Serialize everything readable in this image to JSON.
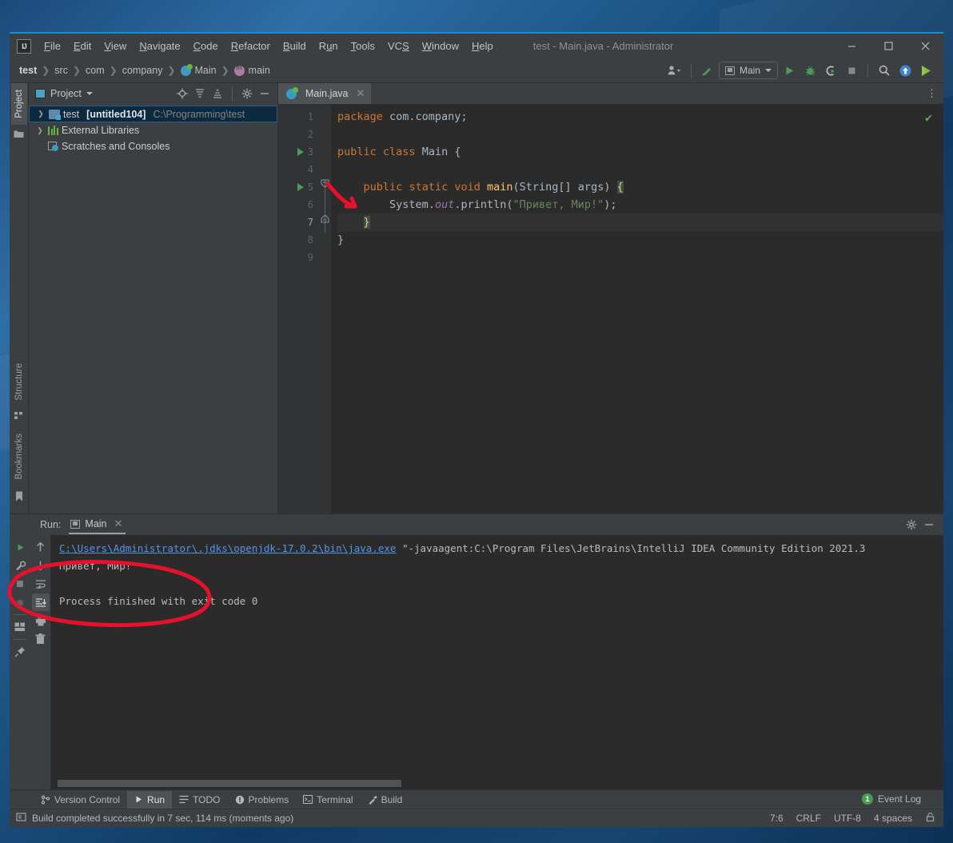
{
  "window": {
    "title": "test - Main.java - Administrator",
    "logo_text": "IJ",
    "controls": {
      "minimize": "—",
      "maximize": "☐",
      "close": "✕"
    }
  },
  "menu": [
    {
      "label": "File",
      "accel": "F"
    },
    {
      "label": "Edit",
      "accel": "E"
    },
    {
      "label": "View",
      "accel": "V"
    },
    {
      "label": "Navigate",
      "accel": "N"
    },
    {
      "label": "Code",
      "accel": "C"
    },
    {
      "label": "Refactor",
      "accel": "R"
    },
    {
      "label": "Build",
      "accel": "B"
    },
    {
      "label": "Run",
      "accel": "u"
    },
    {
      "label": "Tools",
      "accel": "T"
    },
    {
      "label": "VCS",
      "accel": "S"
    },
    {
      "label": "Window",
      "accel": "W"
    },
    {
      "label": "Help",
      "accel": "H"
    }
  ],
  "breadcrumbs": [
    {
      "label": "test",
      "icon": "none",
      "bold": true
    },
    {
      "label": "src",
      "icon": "none",
      "bold": false
    },
    {
      "label": "com",
      "icon": "none",
      "bold": false
    },
    {
      "label": "company",
      "icon": "none",
      "bold": false
    },
    {
      "label": "Main",
      "icon": "class-icon",
      "bold": false
    },
    {
      "label": "main",
      "icon": "method-icon",
      "bold": false
    }
  ],
  "toolbar": {
    "user_icon": "user-dropdown-icon",
    "update_project_icon": "update-project-icon",
    "run_config": "Main",
    "run_icon": "run-icon",
    "debug_icon": "debug-icon",
    "coverage_icon": "run-with-coverage-icon",
    "stop_icon": "stop-icon",
    "search_icon": "search-everywhere-icon",
    "push_icon": "push-icon",
    "idea_feature_icon": "ide-features-trainer-icon"
  },
  "left_stripe": {
    "project_tab": "Project",
    "folder_icon": "folder-icon",
    "structure_tab": "Structure",
    "bookmarks_tab": "Bookmarks",
    "bookmark_icon": "bookmark-icon",
    "structure_icon": "structure-icon"
  },
  "project_panel": {
    "title": "Project",
    "icons": [
      "locate-icon",
      "expand-all-icon",
      "collapse-all-icon",
      "settings-gear-icon",
      "hide-icon"
    ],
    "tree": [
      {
        "label": "test",
        "badge": "[untitled104]",
        "path": "C:\\Programming\\test",
        "icon": "module-icon",
        "expandable": true,
        "selected": true
      },
      {
        "label": "External Libraries",
        "badge": "",
        "path": "",
        "icon": "library-icon",
        "expandable": true,
        "selected": false
      },
      {
        "label": "Scratches and Consoles",
        "badge": "",
        "path": "",
        "icon": "scratches-icon",
        "expandable": false,
        "selected": false
      }
    ]
  },
  "editor": {
    "tab": {
      "label": "Main.java",
      "icon": "java-class-icon",
      "close": "✕"
    },
    "menu_icon": "editor-options-icon",
    "inspection_status": "✔",
    "lines": [
      {
        "n": "1",
        "run_marker": false,
        "current": false
      },
      {
        "n": "2",
        "run_marker": false,
        "current": false
      },
      {
        "n": "3",
        "run_marker": true,
        "current": false
      },
      {
        "n": "4",
        "run_marker": false,
        "current": false
      },
      {
        "n": "5",
        "run_marker": true,
        "current": false
      },
      {
        "n": "6",
        "run_marker": false,
        "current": false
      },
      {
        "n": "7",
        "run_marker": false,
        "current": true
      },
      {
        "n": "8",
        "run_marker": false,
        "current": false
      },
      {
        "n": "9",
        "run_marker": false,
        "current": false
      }
    ],
    "code": {
      "l1_kw": "package",
      "l1_rest": " com.company;",
      "l3_kw1": "public",
      "l3_kw2": "class",
      "l3_name": "Main",
      "l3_brace": "{",
      "l5_kw1": "public",
      "l5_kw2": "static",
      "l5_kw3": "void",
      "l5_name": "main",
      "l5_args": "(String[] args) ",
      "l5_brace": "{",
      "l6_obj": "System.",
      "l6_fld": "out",
      "l6_call": ".println(",
      "l6_str": "\"Привет, Мир!\"",
      "l6_end": ");",
      "l7_brace": "}",
      "l8_brace": "}"
    }
  },
  "run_window": {
    "label": "Run:",
    "tab": "Main",
    "tab_close": "✕",
    "tab_icon": "run-configuration-icon",
    "gear_icon": "settings-gear-icon",
    "hide_icon": "hide-icon",
    "side_buttons_left": [
      "rerun-icon",
      "wrench-icon",
      "stop-icon",
      "debug-icon",
      "layout-icon",
      "pin-icon"
    ],
    "side_buttons_right": [
      "up-arrow-icon",
      "down-arrow-icon",
      "soft-wrap-icon",
      "scroll-to-end-icon",
      "print-icon",
      "trash-icon"
    ],
    "console": {
      "cmd_link": "C:\\Users\\Administrator\\.jdks\\openjdk-17.0.2\\bin\\java.exe",
      "cmd_rest": " \"-javaagent:C:\\Program Files\\JetBrains\\IntelliJ IDEA Community Edition 2021.3",
      "output": "Привет, Мир!",
      "finish": "Process finished with exit code 0"
    }
  },
  "bottom_tabs": [
    {
      "label": "Version Control",
      "icon": "branch-icon",
      "active": false
    },
    {
      "label": "Run",
      "icon": "run-icon",
      "active": true
    },
    {
      "label": "TODO",
      "icon": "todo-icon",
      "active": false
    },
    {
      "label": "Problems",
      "icon": "problems-icon",
      "active": false
    },
    {
      "label": "Terminal",
      "icon": "terminal-icon",
      "active": false
    },
    {
      "label": "Build",
      "icon": "build-hammer-icon",
      "active": false
    }
  ],
  "event_log": {
    "label": "Event Log",
    "count": "1"
  },
  "statusbar": {
    "icon": "memory-indicator-icon",
    "message": "Build completed successfully in 7 sec, 114 ms (moments ago)",
    "caret": "7:6",
    "line_separator": "CRLF",
    "encoding": "UTF-8",
    "indent": "4 spaces",
    "lock_icon": "lock-icon"
  },
  "annotations": {
    "arrow": "red-arrow-pointing-to-println",
    "ellipse": "red-ellipse-around-console-output"
  },
  "colors": {
    "accent_blue": "#1e8ad6",
    "panel_bg": "#3c3f41",
    "editor_bg": "#2b2b2b",
    "keyword": "#cc7832",
    "string": "#6a8759",
    "method": "#ffc66d",
    "field": "#9876aa",
    "run_green": "#499c54",
    "annotation_red": "#e8112d"
  }
}
